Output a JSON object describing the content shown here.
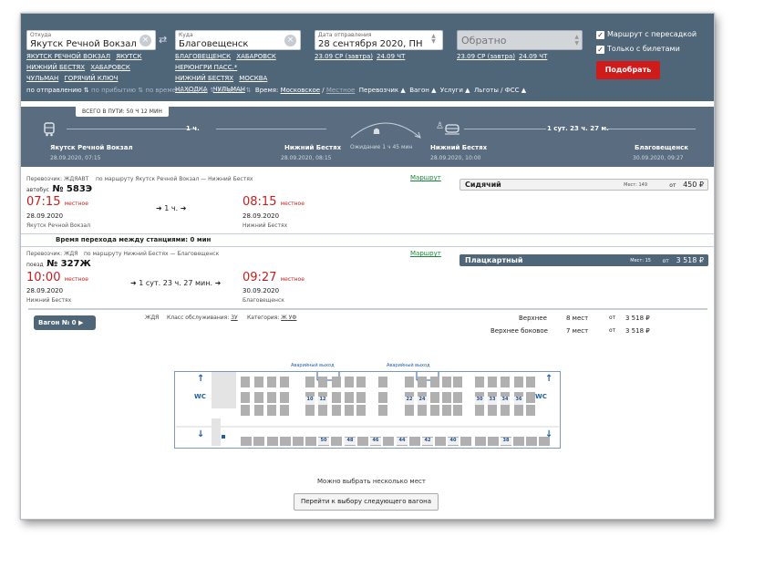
{
  "search": {
    "from": {
      "caption": "Откуда",
      "value": "Якутск Речной Вокзал",
      "clear": "×",
      "suggestions": [
        "ЯКУТСК РЕЧНОЙ ВОКЗАЛ",
        "ЯКУТСК",
        "НИЖНИЙ БЕСТЯХ",
        "ХАБАРОВСК",
        "ЧУЛЬМАН",
        "ГОРЯЧИЙ КЛЮЧ"
      ]
    },
    "swap": "⇄",
    "to": {
      "caption": "Куда",
      "value": "Благовещенск",
      "clear": "×",
      "suggestions": [
        "БЛАГОВЕЩЕНСК",
        "ХАБАРОВСК",
        "НЕРЮНГРИ ПАСС.*",
        "НИЖНИЙ БЕСТЯХ",
        "МОСКВА",
        "НАХОДКА",
        "ЧУЛЬМАН"
      ]
    },
    "date": {
      "caption": "Дата отправления",
      "value": "28 сентября 2020, ПН",
      "quick": [
        "23.09 СР (завтра)",
        "24.09 ЧТ"
      ]
    },
    "back": {
      "value": "Обратно",
      "quick": [
        "23.09 СР (завтра)",
        "24.09 ЧТ"
      ]
    },
    "check_transfer": "Маршрут с пересадкой",
    "check_tickets": "Только с билетами",
    "find_button": "Подобрать",
    "sort": {
      "by_departure": "по отправлению",
      "by_arrival": "по прибытию",
      "by_time": "по времени в пути",
      "by_price": "по цене",
      "time_label": "Время:",
      "moscow": "Московское",
      "slash": "/",
      "local": "Местное",
      "filters": [
        "Перевозчик ▲",
        "Вагон ▲",
        "Услуги ▲",
        "Льготы / ФСС ▲"
      ]
    }
  },
  "route": {
    "total": "ВСЕГО В ПУТИ: 50 Ч 12 МИН",
    "seg1_dur": "1 ч.",
    "seg2_dur": "1 сут. 23 ч. 27 м.",
    "wait": "Ожидание 1 ч 45 мин",
    "stops": [
      {
        "name": "Якутск Речной Вокзал",
        "time": "28.09.2020, 07:15"
      },
      {
        "name": "Нижний Бестях",
        "time": "28.09.2020, 08:15"
      },
      {
        "name": "Нижний Бестях",
        "time": "28.09.2020, 10:00"
      },
      {
        "name": "Благовещенск",
        "time": "30.09.2020, 09:27"
      }
    ]
  },
  "legs": [
    {
      "carrier": "Перевозчик: ЖДЯАВТ",
      "route": "по маршруту Якутск Речной Вокзал — Нижний Бестях",
      "map": "Маршрут",
      "kind": "автобус",
      "number": "№ 583Э",
      "dep_time": "07:15",
      "dep_tz": "местное",
      "dep_date": "28.09.2020",
      "dep_station": "Якутск Речной Вокзал",
      "duration": "1 ч.",
      "arr_time": "08:15",
      "arr_tz": "местное",
      "arr_date": "28.09.2020",
      "arr_station": "Нижний Бестях",
      "class": "Сидячий",
      "seats": "Мест: 149",
      "from": "от",
      "price": "450 ₽"
    },
    {
      "carrier": "Перевозчик: ЖДЯ",
      "route": "по маршруту Нижний Бестях — Благовещенск",
      "map": "Маршрут",
      "kind": "поезд",
      "number": "№ 327Ж",
      "dep_time": "10:00",
      "dep_tz": "местное",
      "dep_date": "28.09.2020",
      "dep_station": "Нижний Бестях",
      "duration": "1 сут. 23 ч. 27 мин.",
      "arr_time": "09:27",
      "arr_tz": "местное",
      "arr_date": "30.09.2020",
      "arr_station": "Благовещенск",
      "class": "Плацкартный",
      "seats": "Мест: 15",
      "from": "от",
      "price": "3 518 ₽"
    }
  ],
  "transfer": "Время перехода между станциями: 0 мин",
  "wagon": {
    "button": "Вагон № 0",
    "carrier": "ЖДЯ",
    "service_label": "Класс обслуживания:",
    "service": "3У",
    "cat_label": "Категория:",
    "cat": "Ж УФ",
    "prices": [
      {
        "name": "Верхнее",
        "count": "8 мест",
        "from": "от",
        "price": "3 518 ₽"
      },
      {
        "name": "Верхнее боковое",
        "count": "7 мест",
        "from": "от",
        "price": "3 518 ₽"
      }
    ],
    "exit": "Аварийный выход",
    "wc": "WC",
    "top_numbers": [
      "10",
      "12",
      "22",
      "24",
      "30",
      "33",
      "34",
      "36"
    ],
    "bottom_numbers": [
      "50",
      "48",
      "46",
      "44",
      "42",
      "40",
      "38"
    ]
  },
  "note": "Можно выбрать несколько мест",
  "next_button": "Перейти к выбору следующего вагона"
}
